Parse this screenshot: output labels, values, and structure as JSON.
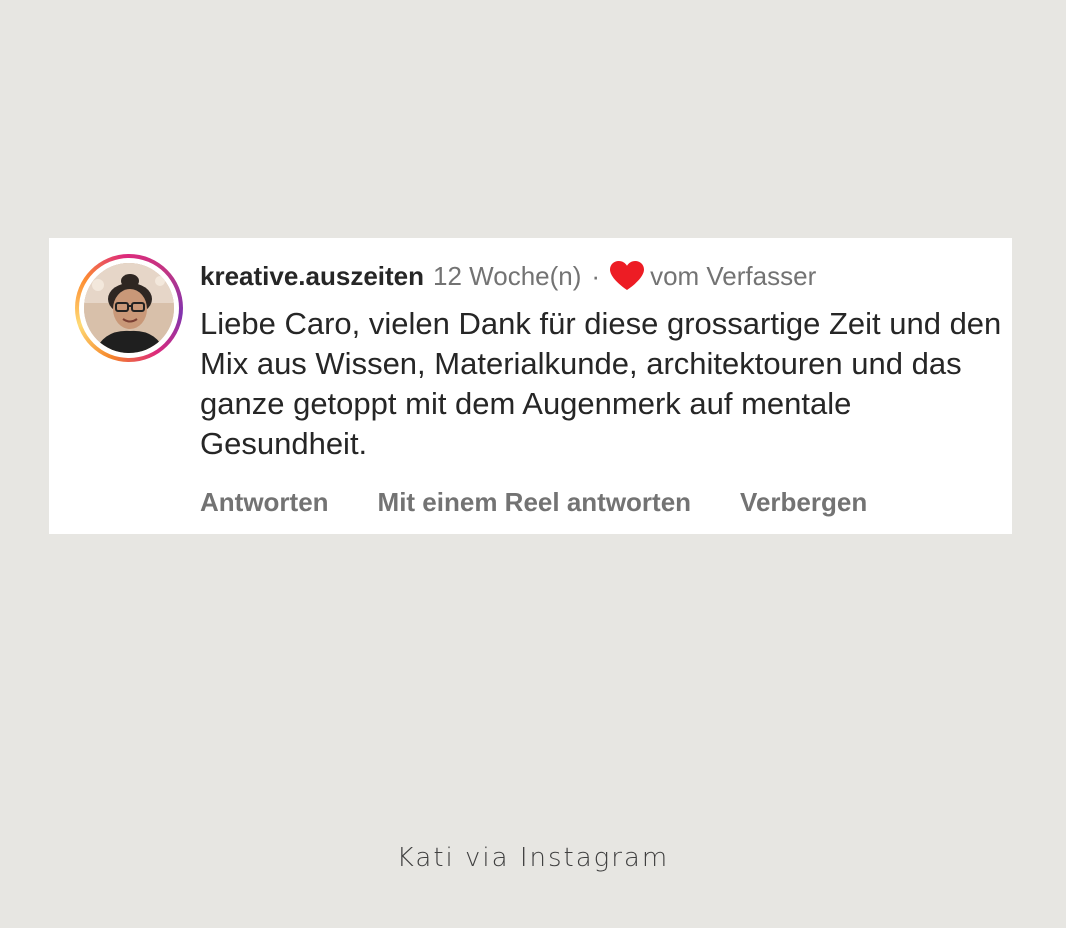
{
  "comment": {
    "username": "kreative.auszeiten",
    "time": "12 Woche(n)",
    "separator": "·",
    "liked_icon": "heart-icon",
    "liked_by": "vom Verfasser",
    "text": "Liebe Caro, vielen Dank für diese grossartige Zeit und den Mix aus Wissen, Materialkunde, architektouren und das ganze getoppt mit dem Augenmerk auf mentale Gesundheit.",
    "actions": {
      "reply": "Antworten",
      "reply_reel": "Mit einem Reel antworten",
      "hide": "Verbergen"
    }
  },
  "caption": "Kati via Instagram",
  "colors": {
    "background": "#e7e6e2",
    "card": "#ffffff",
    "heart": "#ed1c24",
    "text_primary": "#262626",
    "text_secondary": "#737373"
  }
}
